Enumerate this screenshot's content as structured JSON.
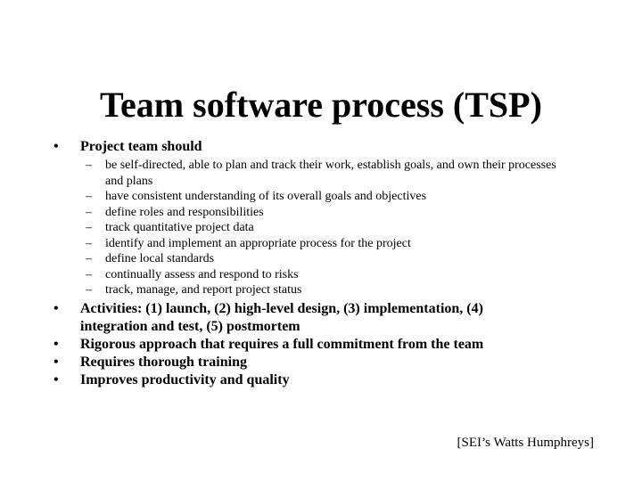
{
  "slide": {
    "title": "Team software process (TSP)",
    "bullet_marker": "•",
    "sub_bullet_marker": "–",
    "background_color": "#ffffff",
    "text_color": "#000000"
  },
  "body": {
    "bullets": [
      {
        "text": "Project team should",
        "sub_bullets": [
          "be self-directed, able to plan and track their work, establish goals, and own their processes and plans",
          "have consistent understanding of its overall goals and objectives",
          "define roles and responsibilities",
          "track quantitative project data",
          "identify and implement an appropriate process for the project",
          "define local standards",
          "continually assess and respond to risks",
          "track, manage, and report project status"
        ]
      },
      {
        "text": "Activities:  (1) launch, (2) high-level design, (3) implementation, (4) integration and test, (5) postmortem",
        "sub_bullets": []
      },
      {
        "text": "Rigorous approach that requires a full commitment from the team",
        "sub_bullets": []
      },
      {
        "text": "Requires thorough training",
        "sub_bullets": []
      },
      {
        "text": "Improves productivity and quality",
        "sub_bullets": []
      }
    ]
  },
  "attribution": {
    "text": "[SEI’s Watts Humphreys]"
  }
}
